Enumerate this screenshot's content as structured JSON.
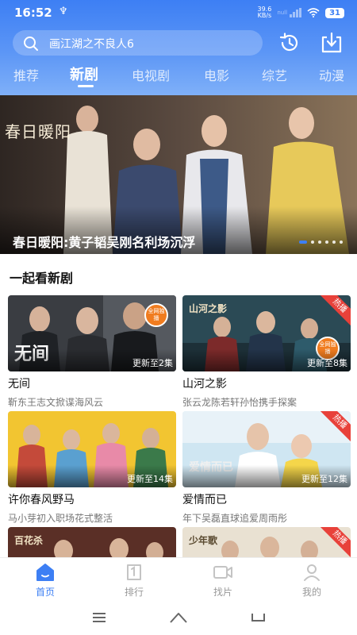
{
  "status_bar": {
    "time": "16:52",
    "usb_symbol": "♆",
    "net_speed": "39.6",
    "net_unit": "KB/s",
    "signal_label": "null",
    "battery": "31"
  },
  "search": {
    "text": "画江湖之不良人6"
  },
  "tabs": [
    {
      "label": "推荐"
    },
    {
      "label": "新剧"
    },
    {
      "label": "电视剧"
    },
    {
      "label": "电影"
    },
    {
      "label": "综艺"
    },
    {
      "label": "动漫"
    }
  ],
  "active_tab": "新剧",
  "banner": {
    "logo_text": "春日暖阳",
    "caption": "春日暖阳:黄子韬吴刚名利场沉浮",
    "slide_count": 6,
    "active_slide": 1
  },
  "section": {
    "title": "一起看新剧"
  },
  "cards": [
    {
      "title": "无间",
      "subtitle": "靳东王志文掀谍海风云",
      "episode": "更新至2集",
      "badge": "",
      "round_badge": "全网独播",
      "poster_word": "无间"
    },
    {
      "title": "山河之影",
      "subtitle": "张云龙陈若轩孙怡携手探案",
      "episode": "更新至8集",
      "badge": "热播",
      "round_badge": "全网独播",
      "poster_word": "山河之影"
    },
    {
      "title": "许你春风野马",
      "subtitle": "马小芽初入职场花式整活",
      "episode": "更新至14集",
      "badge": "",
      "round_badge": "",
      "poster_word": ""
    },
    {
      "title": "爱情而已",
      "subtitle": "年下吴磊直球追爱周雨彤",
      "episode": "更新至12集",
      "badge": "热播",
      "round_badge": "",
      "poster_word": "爱情而已"
    },
    {
      "title": "",
      "subtitle": "",
      "episode": "",
      "badge": "",
      "round_badge": "",
      "poster_word": "百花杀"
    },
    {
      "title": "",
      "subtitle": "",
      "episode": "",
      "badge": "热播",
      "round_badge": "",
      "poster_word": "少年歌"
    }
  ],
  "bottom_nav": [
    {
      "label": "首页",
      "icon": "home-icon",
      "active": true
    },
    {
      "label": "排行",
      "icon": "ranking-icon",
      "active": false
    },
    {
      "label": "找片",
      "icon": "video-camera-icon",
      "active": false
    },
    {
      "label": "我的",
      "icon": "profile-icon",
      "active": false
    }
  ],
  "colors": {
    "accent": "#3d7ff4",
    "hot_badge": "#e8413a",
    "round_badge": "#f07c1f"
  }
}
